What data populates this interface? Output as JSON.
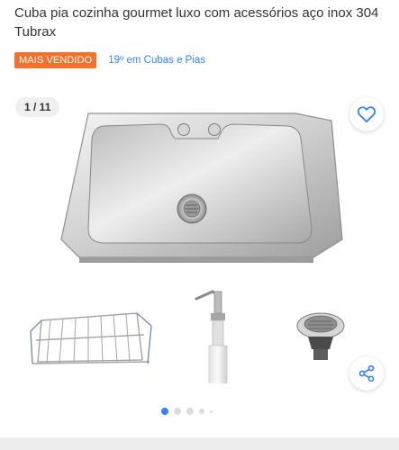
{
  "product": {
    "title": "Cuba pia cozinha gourmet luxo com acessórios aço inox 304 Tubrax",
    "badge": "MAIS VENDIDO",
    "ranking": "19º em Cubas e Pias"
  },
  "gallery": {
    "counter": "1 / 11",
    "current_index": 1,
    "total_images": 11,
    "favorite_icon": "heart-outline-icon",
    "share_icon": "share-icon"
  },
  "colors": {
    "badge": "#f2712c",
    "link": "#3483fa",
    "active_dot": "#3483fa",
    "inactive_dot": "#dcdcdc"
  }
}
